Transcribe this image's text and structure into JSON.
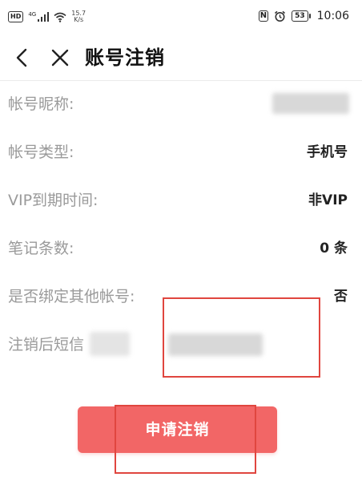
{
  "status_bar": {
    "hd_label": "HD",
    "net_type": "4G",
    "speed_value": "15.7",
    "speed_unit": "K/s",
    "nfc_label": "N",
    "battery_label": "53",
    "time": "10:06",
    "icons": [
      "hd-icon",
      "signal-icon",
      "wifi-icon",
      "nfc-icon",
      "alarm-icon",
      "battery-icon"
    ]
  },
  "header": {
    "title": "账号注销",
    "back_icon": "chevron-left-icon",
    "close_icon": "close-icon"
  },
  "rows": [
    {
      "label": "帐号昵称:",
      "value": ""
    },
    {
      "label": "帐号类型:",
      "value": "手机号"
    },
    {
      "label": "VIP到期时间:",
      "value": "非VIP"
    },
    {
      "label": "笔记条数:",
      "value": "0 条"
    },
    {
      "label": "是否绑定其他帐号:",
      "value": "否"
    },
    {
      "label": "注销后短信",
      "value": ""
    }
  ],
  "apply_button": {
    "label": "申请注销"
  },
  "colors": {
    "accent": "#f26666",
    "annotation": "#e0463f",
    "label_gray": "#9a9a9a",
    "value_dark": "#222222"
  }
}
